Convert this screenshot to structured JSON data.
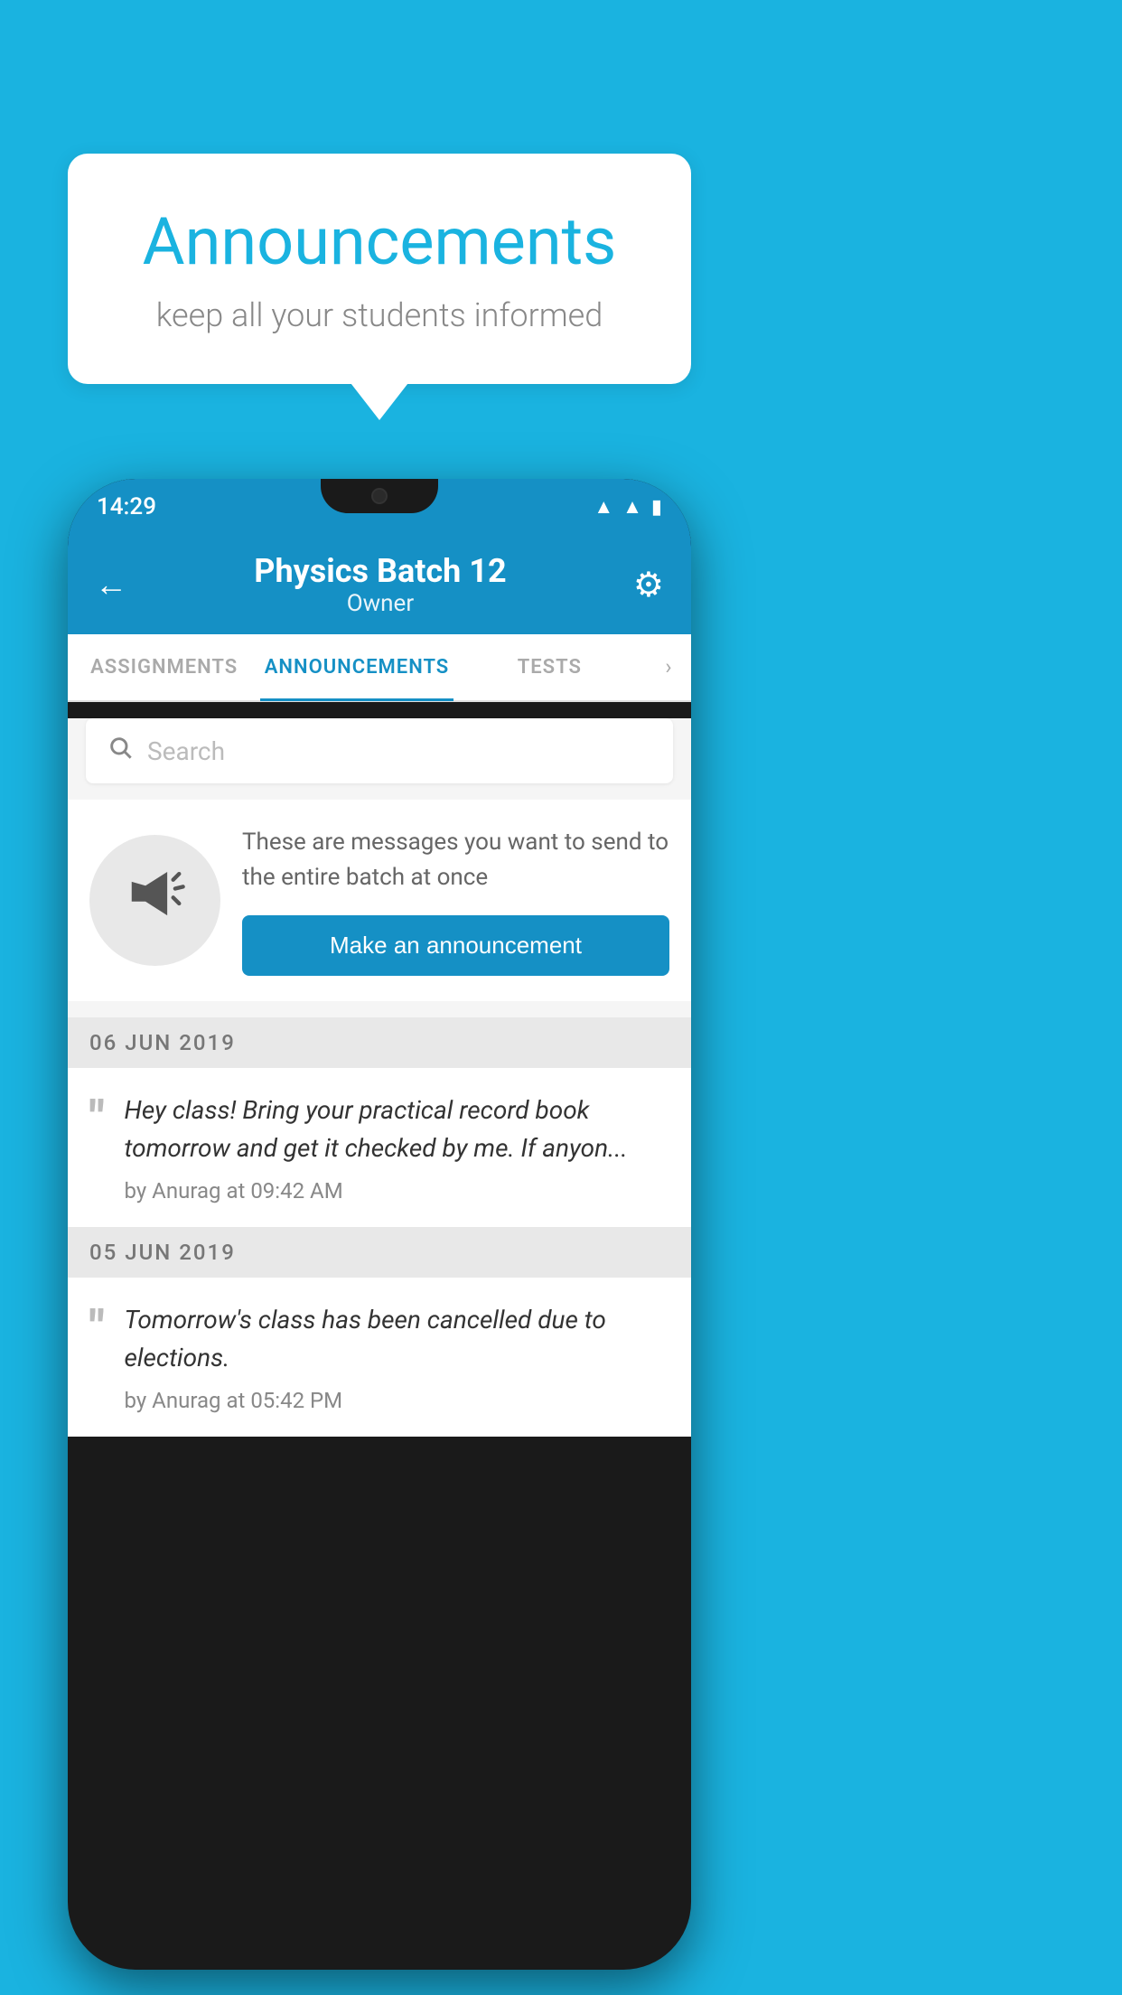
{
  "bubble": {
    "title": "Announcements",
    "subtitle": "keep all your students informed"
  },
  "phone": {
    "statusBar": {
      "time": "14:29",
      "icons": [
        "▲",
        "▲",
        "▌▌"
      ]
    },
    "header": {
      "title": "Physics Batch 12",
      "subtitle": "Owner",
      "backArrow": "←",
      "settingsIcon": "⚙"
    },
    "tabs": [
      {
        "label": "ASSIGNMENTS",
        "active": false
      },
      {
        "label": "ANNOUNCEMENTS",
        "active": true
      },
      {
        "label": "TESTS",
        "active": false
      }
    ],
    "search": {
      "placeholder": "Search"
    },
    "promoCard": {
      "description": "These are messages you want to send to the entire batch at once",
      "buttonLabel": "Make an announcement"
    },
    "announcements": [
      {
        "date": "06  JUN  2019",
        "text": "Hey class! Bring your practical record book tomorrow and get it checked by me. If anyon...",
        "author": "by Anurag at 09:42 AM"
      },
      {
        "date": "05  JUN  2019",
        "text": "Tomorrow's class has been cancelled due to elections.",
        "author": "by Anurag at 05:42 PM"
      }
    ]
  },
  "colors": {
    "background": "#1ab3e0",
    "headerBg": "#1590c5",
    "accentBlue": "#1590c5",
    "tabActive": "#1590c5"
  }
}
